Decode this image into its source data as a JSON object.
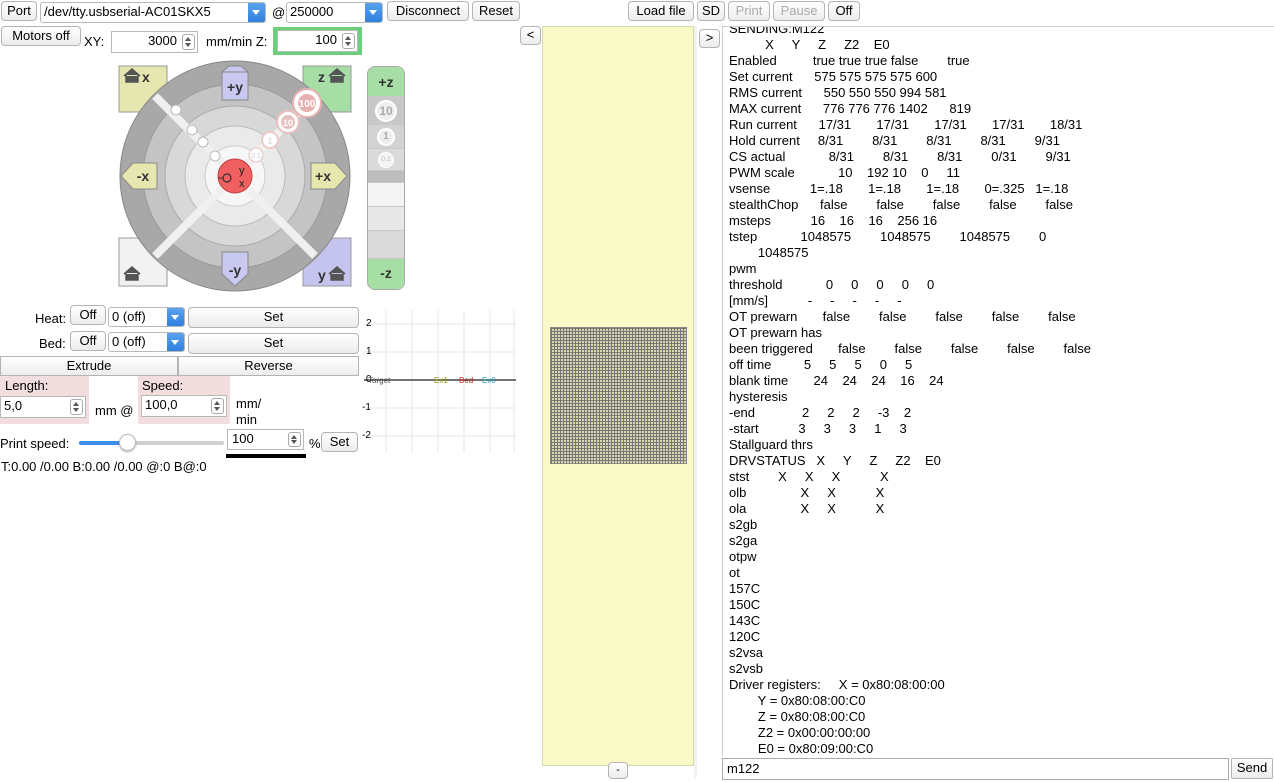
{
  "toolbar": {
    "port_label": "Port",
    "port_value": "/dev/tty.usbserial-AC01SKX5",
    "at_label": "@",
    "baud_value": "250000",
    "disconnect_label": "Disconnect",
    "reset_label": "Reset",
    "load_file_label": "Load file",
    "sd_label": "SD",
    "print_label": "Print",
    "pause_label": "Pause",
    "off_label": "Off"
  },
  "motion": {
    "motors_off_label": "Motors off",
    "xy_label": "XY:",
    "xy_value": "3000",
    "units_label": "mm/min Z:",
    "z_value": "100"
  },
  "jog": {
    "home_x": "x",
    "home_z": "z",
    "home_all": "",
    "home_y": "y",
    "plus_y": "+y",
    "minus_y": "-y",
    "minus_x": "-x",
    "plus_x": "+x",
    "step_100": "100",
    "step_10": "10",
    "step_1": "1",
    "step_01": "0.1",
    "plus_z": "+z",
    "minus_z": "-z",
    "z_step_10": "10",
    "z_step_1": "1",
    "z_step_01": "0.1",
    "center_y": "y",
    "center_x": "x"
  },
  "temps": {
    "heat_label": "Heat:",
    "heat_off": "Off",
    "heat_value": "0 (off)",
    "heat_set": "Set",
    "bed_label": "Bed:",
    "bed_off": "Off",
    "bed_value": "0 (off)",
    "bed_set": "Set"
  },
  "extrude": {
    "extrude_label": "Extrude",
    "reverse_label": "Reverse",
    "length_label": "Length:",
    "length_value": "5,0",
    "mm_at": "mm @",
    "speed_label": "Speed:",
    "speed_value": "100,0",
    "speed_unit_1": "mm/",
    "speed_unit_2": "min"
  },
  "print_speed": {
    "label": "Print speed:",
    "value": "100",
    "percent": "%",
    "set_label": "Set",
    "slider_level": 0.34
  },
  "status_line": "T:0.00 /0.00 B:0.00 /0.00 @:0 B@:0",
  "graph": {
    "y_ticks": [
      "2",
      "1",
      "0",
      "-1",
      "-2"
    ],
    "legend": [
      {
        "label": "Target",
        "color": "#555555"
      },
      {
        "label": "Ex1",
        "color": "#9a9a00"
      },
      {
        "label": "Bed",
        "color": "#d02020"
      },
      {
        "label": "Ex0",
        "color": "#20a0c0"
      }
    ]
  },
  "panels": {
    "collapse_left": "<",
    "collapse_right": ">",
    "minus": "-"
  },
  "console": {
    "lines": [
      "SENDING:M122",
      "          X     Y     Z     Z2    E0",
      "Enabled          true true true false        true",
      "Set current      575 575 575 575 600",
      "RMS current      550 550 550 994 581",
      "MAX current      776 776 776 1402      819",
      "Run current      17/31       17/31       17/31       17/31       18/31",
      "Hold current     8/31        8/31        8/31        8/31        9/31",
      "CS actual            8/31        8/31        8/31        0/31        9/31",
      "PWM scale            10    192 10    0     11",
      "vsense           1=.18       1=.18       1=.18       0=.325   1=.18",
      "stealthChop      false        false        false        false        false",
      "msteps           16    16    16    256 16",
      "tstep            1048575        1048575        1048575        0",
      "        1048575",
      "pwm",
      "threshold            0     0     0     0     0",
      "[mm/s]           -     -     -     -     -",
      "OT prewarn       false        false        false        false        false",
      "OT prewarn has",
      "been triggered       false        false        false        false        false",
      "off time         5     5     5     0     5",
      "blank time       24    24    24    16    24",
      "hysteresis",
      "-end             2     2     2     -3    2",
      "-start           3     3     3     1     3",
      "Stallguard thrs",
      "DRVSTATUS   X     Y     Z     Z2    E0",
      "stst        X     X     X           X",
      "olb               X     X           X",
      "ola               X     X           X",
      "s2gb",
      "s2ga",
      "otpw",
      "ot",
      "157C",
      "150C",
      "143C",
      "120C",
      "s2vsa",
      "s2vsb",
      "Driver registers:     X = 0x80:08:00:00",
      "        Y = 0x80:08:00:C0",
      "        Z = 0x80:08:00:C0",
      "        Z2 = 0x00:00:00:00",
      "        E0 = 0x80:09:00:C0"
    ],
    "input_value": "m122",
    "send_label": "Send"
  },
  "colors": {
    "viewer_bg": "#fafac8",
    "z_highlight": "#6ad07a",
    "home_xy_color": "#e8e8b8",
    "home_z_color": "#a8e0a8",
    "home_y_color": "#c8c8f0",
    "center_red": "#f06060"
  }
}
